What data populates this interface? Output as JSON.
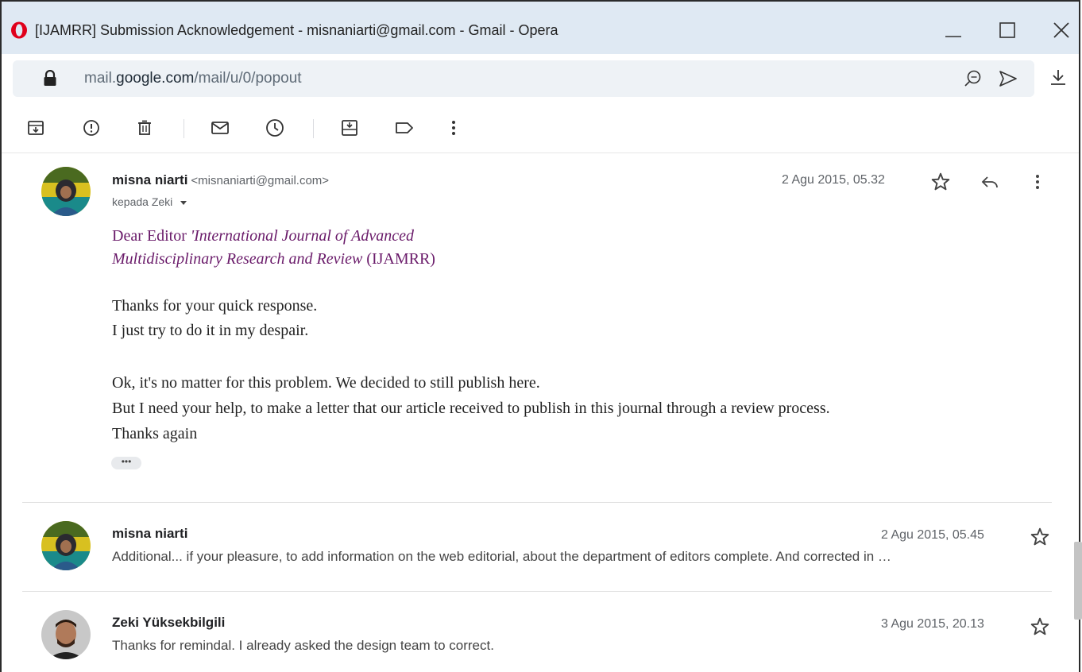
{
  "window": {
    "title": "[IJAMRR] Submission Acknowledgement - misnaniarti@gmail.com - Gmail - Opera",
    "minimize_icon": "minimize-icon",
    "maximize_icon": "maximize-icon",
    "close_icon": "close-icon"
  },
  "address_bar": {
    "url_prefix": "mail.",
    "url_host": "google.com",
    "url_path": "/mail/u/0/popout"
  },
  "toolbar": {
    "icons": [
      "archive-icon",
      "report-spam-icon",
      "delete-icon",
      "mark-unread-icon",
      "snooze-icon",
      "move-to-icon",
      "label-icon",
      "more-vert-icon"
    ]
  },
  "messages": {
    "expanded": {
      "sender_name": "misna niarti",
      "sender_email": "<misnaniarti@gmail.com>",
      "to_line": "kepada Zeki",
      "date": "2 Agu 2015, 05.32",
      "greeting_plain": "Dear Editor ",
      "greeting_italic_1": "'International Journal of Advanced",
      "greeting_italic_2": "Multidisciplinary Research and Review",
      "greeting_suffix": " (IJAMRR)",
      "paragraph1_line1": "Thanks for your quick response.",
      "paragraph1_line2": "I just try to do it in my despair.",
      "paragraph2_line1": "Ok, it's no matter for this problem. We decided to still publish here.",
      "paragraph2_line2": "But I need your help, to make a letter that our article received to publish in this journal through a review process.",
      "paragraph2_line3": "Thanks again",
      "trimmed_content": "•••"
    },
    "collapsed": [
      {
        "sender_name": "misna niarti",
        "date": "2 Agu 2015, 05.45",
        "snippet": "Additional... if your pleasure, to add information on the web editorial, about the department of editors complete. And corrected in …"
      },
      {
        "sender_name": "Zeki Yüksekbilgili",
        "date": "3 Agu 2015, 20.13",
        "snippet": "Thanks for remindal. I already asked the design team to correct."
      }
    ]
  },
  "colors": {
    "titlebar": "#dfe9f3",
    "opera_red": "#e0001b",
    "body_purple": "#6a1b6a"
  }
}
